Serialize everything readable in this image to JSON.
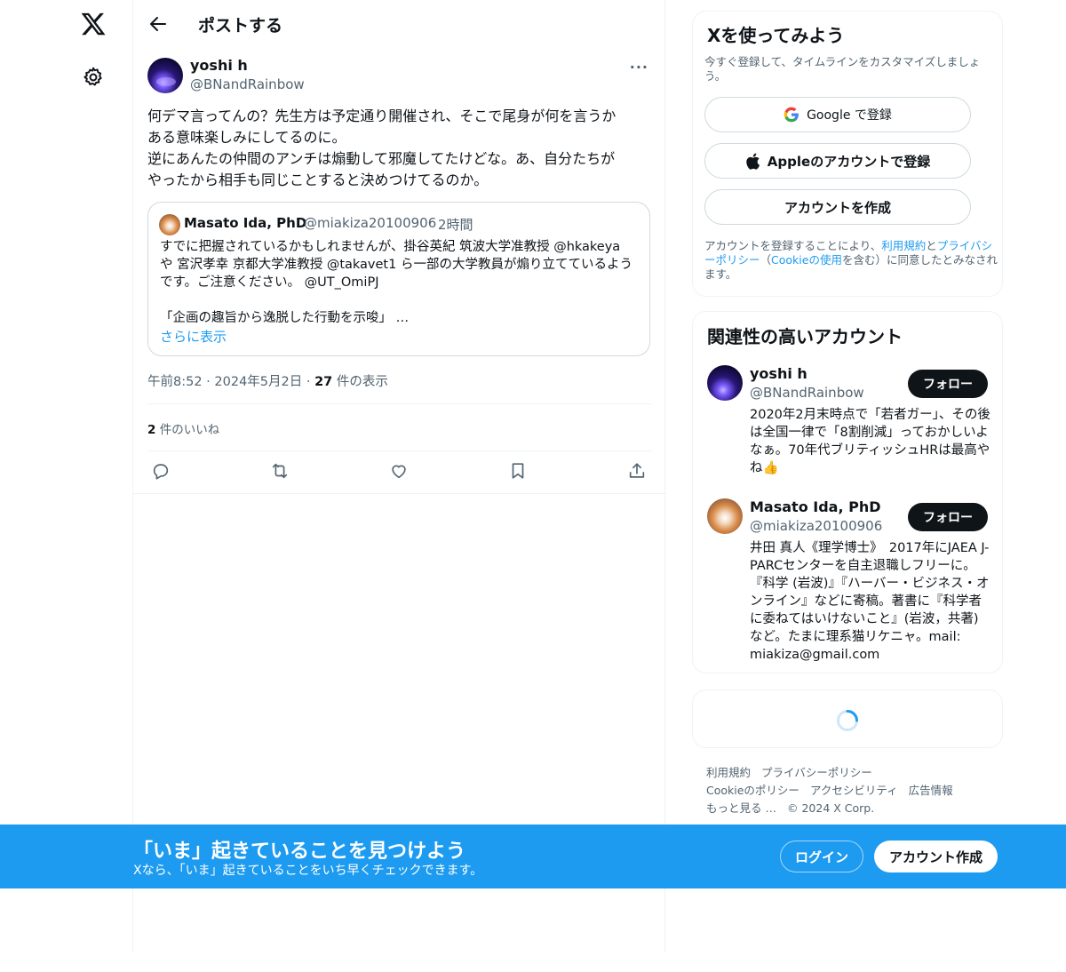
{
  "nav": {
    "logo_icon": "x-logo-icon",
    "settings_icon": "gear-icon"
  },
  "header": {
    "title": "ポストする"
  },
  "post": {
    "author_name": "yoshi h",
    "author_handle": "@BNandRainbow",
    "text": "何デマ言ってんの？先生方は予定通り開催され、そこで尾身が何を言うか\nある意味楽しみにしてるのに。\n逆にあんたの仲間のアンチは煽動して邪魔してたけどな。あ、自分たちが\nやったから相手も同じことすると決めつけてるのか。",
    "quote": {
      "name": "Masato Ida, PhD",
      "handle": "@miakiza20100906",
      "separator": "·",
      "time": "2時間",
      "text": "すでに把握されているかもしれませんが、掛谷英紀 筑波大学准教授 @hkakeya\nや 宮沢孝幸 京都大学准教授 @takavet1 ら一部の大学教員が煽り立てているよう\nです。ご注意ください。 @UT_OmiPJ\n\n「企画の趣旨から逸脱した行動を示唆」 …",
      "show_more": "さらに表示"
    },
    "time": "午前8:52",
    "date": "2024年5月2日",
    "dot": "·",
    "views_count": "27",
    "views_label": " 件の表示",
    "likes_count": "2",
    "likes_label": " 件のいいね",
    "actions": [
      "reply-icon",
      "repost-icon",
      "like-icon",
      "bookmark-icon",
      "share-icon"
    ]
  },
  "signup": {
    "title": "Xを使ってみよう",
    "subtitle": "今すぐ登録して、タイムラインをカスタマイズしましょう。",
    "google": "Google で登録",
    "apple": "Appleのアカウントで登録",
    "create": "アカウントを作成",
    "legal_1": "アカウントを登録することにより、",
    "legal_terms": "利用規約",
    "legal_2": "と",
    "legal_privacy": "プライバシーポリシー",
    "legal_3": "（",
    "legal_cookie": "Cookieの使用",
    "legal_4": "を含む）に同意したとみなされます。"
  },
  "who": {
    "title": "関連性の高いアカウント",
    "accounts": [
      {
        "name": "yoshi h",
        "handle": "@BNandRainbow",
        "follow": "フォロー",
        "bio": "2020年2月末時点で「若者ガー」、その後は全国一律で「8割削減」っておかしいよなぁ。70年代ブリティッシュHRは最高やね👍"
      },
      {
        "name": "Masato Ida, PhD",
        "handle": "@miakiza20100906",
        "follow": "フォロー",
        "bio": "井田 真人《理学博士》　2017年にJAEA J-PARCセンターを自主退職しフリーに。『科学 (岩波)』『ハーバー・ビジネス・オンライン』などに寄稿。著書に『科学者に委ねてはいけないこと』(岩波，共著) など。たまに理系猫リケニャ。mail: miakiza@gmail.com"
      }
    ]
  },
  "footer": {
    "links": [
      "利用規約",
      "プライバシーポリシー",
      "Cookieのポリシー",
      "アクセシビリティ",
      "広告情報",
      "もっと見る …"
    ],
    "copyright": "© 2024 X Corp."
  },
  "banner": {
    "title": "「いま」起きていることを見つけよう",
    "subtitle": "Xなら、「いま」起きていることをいち早くチェックできます。",
    "login": "ログイン",
    "signup": "アカウント作成"
  },
  "colors": {
    "accent": "#1d9bf0",
    "text": "#0f1419",
    "muted": "#536471",
    "border": "#cfd9de"
  }
}
